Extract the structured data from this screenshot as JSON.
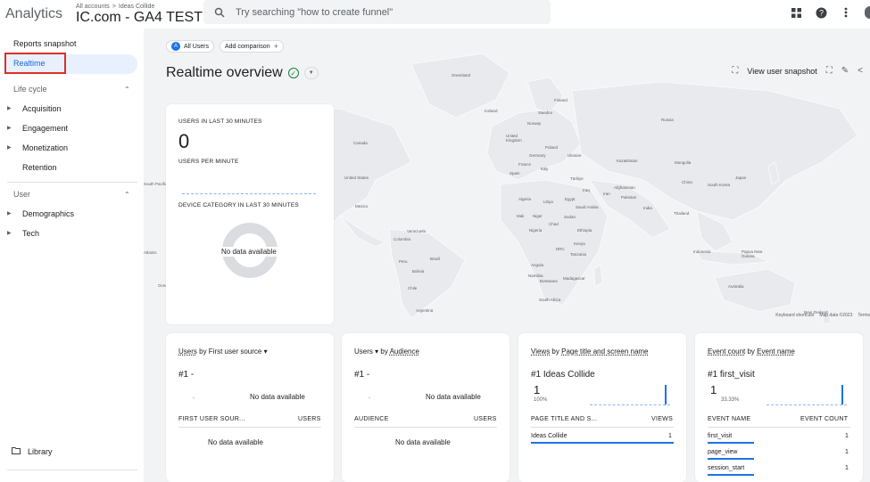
{
  "header": {
    "app_name": "Analytics",
    "breadcrumb": [
      "All accounts",
      ">",
      "Ideas Collide"
    ],
    "property": "IC.com - GA4 TEST",
    "search_placeholder": "Try searching \"how to create funnel\""
  },
  "sidebar": {
    "reports_snapshot": "Reports snapshot",
    "realtime": "Realtime",
    "lifecycle": "Life cycle",
    "lifecycle_items": [
      "Acquisition",
      "Engagement",
      "Monetization",
      "Retention"
    ],
    "user": "User",
    "user_items": [
      "Demographics",
      "Tech"
    ],
    "library": "Library"
  },
  "main": {
    "all_users": "All Users",
    "all_users_badge": "A",
    "add_comparison": "Add comparison",
    "title": "Realtime overview",
    "view_snapshot": "View user snapshot",
    "map_labels": [
      "Greenland",
      "Iceland",
      "Finland",
      "Sweden",
      "Norway",
      "Russia",
      "United Kingdom",
      "Poland",
      "Germany",
      "Ukraine",
      "Kazakhstan",
      "Mongolia",
      "France",
      "Italy",
      "Spain",
      "Türkiye",
      "China",
      "South Korea",
      "Japan",
      "Canada",
      "United States",
      "Mexico",
      "Iraq",
      "Iran",
      "Afghanistan",
      "Pakistan",
      "India",
      "Thailand",
      "Algeria",
      "Libya",
      "Egypt",
      "Saudi Arabia",
      "Mali",
      "Niger",
      "Chad",
      "Sudan",
      "Nigeria",
      "Ethiopia",
      "Venezuela",
      "Colombia",
      "Brazil",
      "Peru",
      "Bolivia",
      "Chile",
      "Argentina",
      "DRC",
      "Kenya",
      "Tanzania",
      "Angola",
      "Namibia",
      "Botswana",
      "Madagascar",
      "South Africa",
      "Indonesia",
      "Papua New Guinea",
      "Australia",
      "New Zealand",
      "South Pacific",
      "Atlantic",
      "Ocean"
    ],
    "map_footer": [
      "Keyboard shortcuts",
      "Map data ©2023",
      "Terms"
    ]
  },
  "realtime_card": {
    "users_label": "USERS IN LAST 30 MINUTES",
    "users_value": "0",
    "per_minute_label": "USERS PER MINUTE",
    "device_label": "DEVICE CATEGORY IN LAST 30 MINUTES",
    "no_data": "No data available"
  },
  "cards": [
    {
      "title_a": "Users",
      "title_b": " by First user source",
      "rank": "#1  -",
      "dot": "-",
      "no_data": "No data available",
      "col1": "FIRST USER SOUR...",
      "col2": "USERS",
      "table_no_data": "No data available"
    },
    {
      "title_a": "Users",
      "title_b": " by ",
      "title_c": "Audience",
      "rank": "#1  -",
      "dot": "-",
      "no_data": "No data available",
      "col1": "AUDIENCE",
      "col2": "USERS",
      "table_no_data": "No data available"
    },
    {
      "title_a": "Views",
      "title_b": " by ",
      "title_c": "Page title and screen name",
      "rank": "#1  Ideas Collide",
      "value": "1",
      "pct": "100%",
      "col1": "PAGE TITLE AND S...",
      "col2": "VIEWS",
      "rows": [
        {
          "name": "Ideas Collide",
          "value": "1"
        }
      ]
    },
    {
      "title_a": "Event count",
      "title_b": " by ",
      "title_c": "Event name",
      "rank": "#1  first_visit",
      "value": "1",
      "pct": "33.33%",
      "col1": "EVENT NAME",
      "col2": "EVENT COUNT",
      "rows": [
        {
          "name": "first_visit",
          "value": "1"
        },
        {
          "name": "page_view",
          "value": "1"
        },
        {
          "name": "session_start",
          "value": "1"
        }
      ]
    }
  ],
  "icons": {
    "search": "search-icon",
    "apps": "apps-icon",
    "help": "help-icon",
    "more": "more-vert-icon",
    "folder": "folder-icon"
  },
  "colors": {
    "accent": "#1a73e8",
    "selected_bg": "#e8f0fe",
    "highlight_box": "#d93025",
    "status_ok": "#188038",
    "map_land": "#e8eaed"
  }
}
